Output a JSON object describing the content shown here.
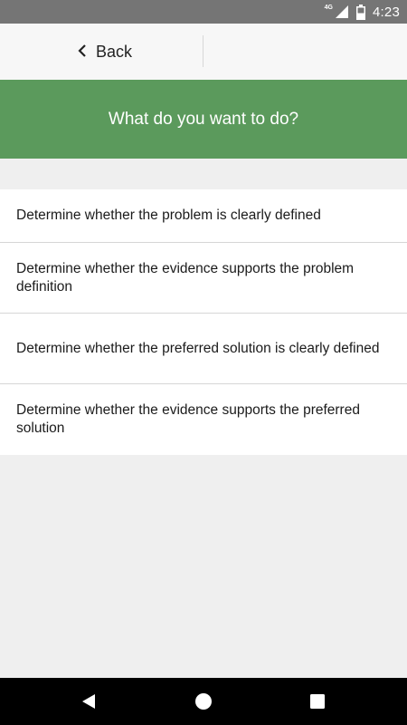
{
  "status_bar": {
    "network": "4G",
    "time": "4:23",
    "icons": [
      "signal-icon",
      "battery-icon"
    ]
  },
  "top_nav": {
    "back_label": "Back",
    "icon": "chevron-left-icon"
  },
  "header": {
    "title": "What do you want to do?",
    "color": "#5b9a5c"
  },
  "options": [
    {
      "label": "Determine whether the problem is clearly defined"
    },
    {
      "label": "Determine whether the evidence supports the problem definition"
    },
    {
      "label": "Determine whether the preferred solution is clearly defined"
    },
    {
      "label": "Determine whether the evidence supports the preferred solution"
    }
  ],
  "system_nav": {
    "icons": [
      "nav-back-icon",
      "nav-home-icon",
      "nav-recents-icon"
    ]
  }
}
